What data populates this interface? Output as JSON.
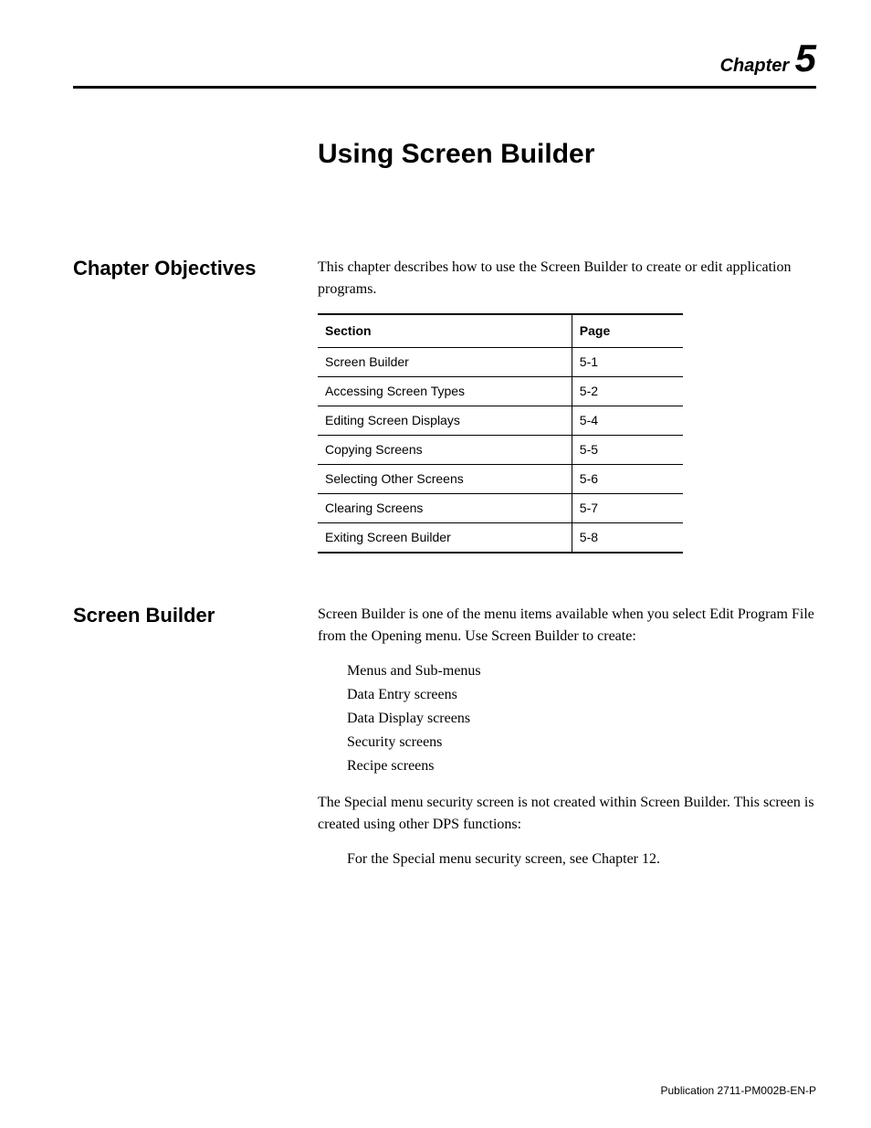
{
  "chapter": {
    "label": "Chapter",
    "number": "5",
    "title": "Using Screen Builder"
  },
  "sections": {
    "objectives": {
      "heading": "Chapter Objectives",
      "intro": "This chapter describes how to use the Screen Builder to create or edit application programs."
    },
    "builder": {
      "heading": "Screen Builder",
      "intro": "Screen Builder is one of the menu items available when you select Edit Program File from the Opening menu. Use Screen Builder to create:",
      "bullets": [
        "Menus and Sub-menus",
        "Data Entry screens",
        "Data Display screens",
        "Security screens",
        "Recipe screens"
      ],
      "para2": "The Special menu security screen is not created within Screen Builder. This screen is created using other DPS functions:",
      "bullets2": [
        "For the Special menu security screen, see Chapter 12."
      ]
    }
  },
  "chart_data": {
    "type": "table",
    "title": "",
    "columns": [
      "Section",
      "Page"
    ],
    "rows": [
      {
        "section": "Screen Builder",
        "page": "5-1"
      },
      {
        "section": "Accessing Screen Types",
        "page": "5-2"
      },
      {
        "section": "Editing Screen Displays",
        "page": "5-4"
      },
      {
        "section": "Copying Screens",
        "page": "5-5"
      },
      {
        "section": "Selecting Other Screens",
        "page": "5-6"
      },
      {
        "section": "Clearing Screens",
        "page": "5-7"
      },
      {
        "section": "Exiting Screen Builder",
        "page": "5-8"
      }
    ]
  },
  "footer": {
    "publication": "Publication 2711-PM002B-EN-P"
  }
}
